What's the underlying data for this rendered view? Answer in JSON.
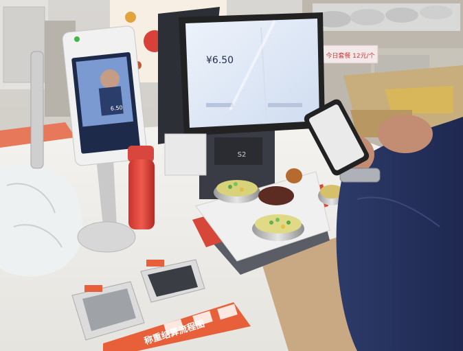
{
  "main_screen": {
    "amount": "¥6.50",
    "model_label": "S2"
  },
  "face_terminal": {
    "amount": "6.50"
  },
  "price_sign": {
    "text": "今日套餐 12元/个"
  },
  "instruction_panel": {
    "title": "称重结算流程图"
  },
  "colors": {
    "counter": "#f2f1ee",
    "panel_orange": "#e8603a",
    "screen_blue": "#2f6fd0",
    "sleeve_navy": "#27345f"
  }
}
